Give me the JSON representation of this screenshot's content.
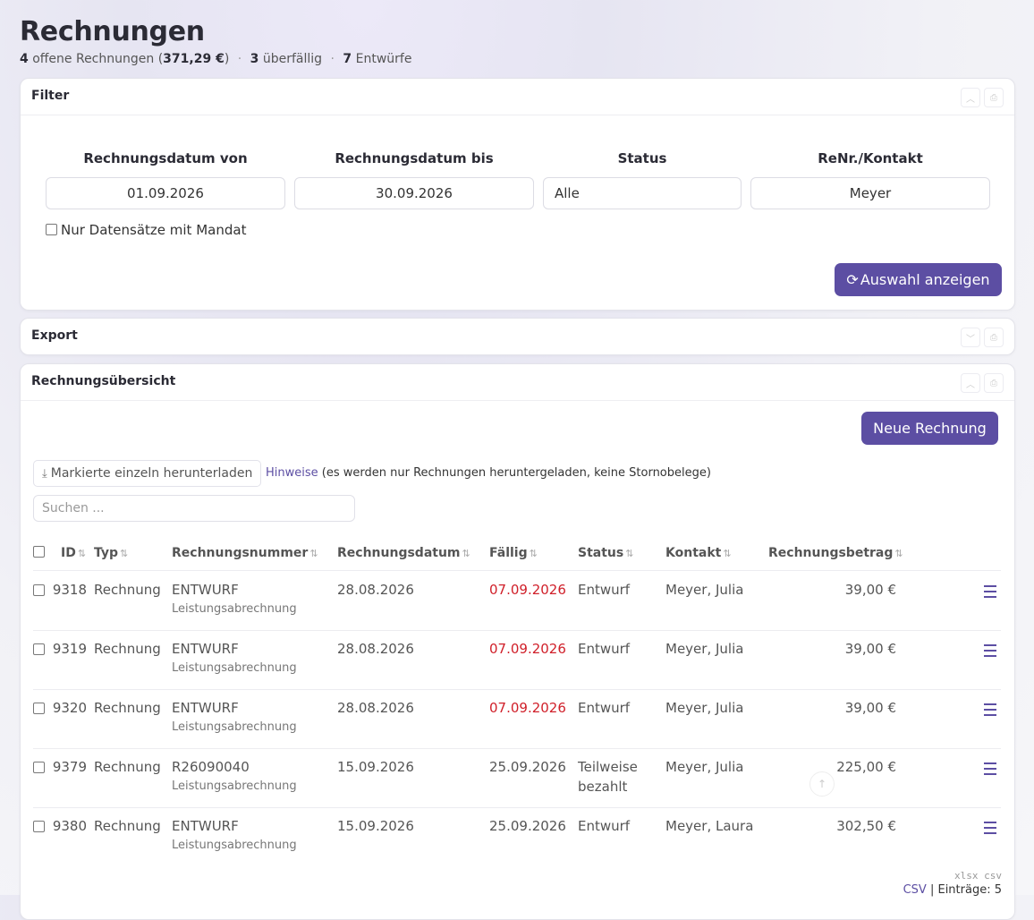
{
  "page": {
    "title": "Rechnungen",
    "summary": {
      "open_count": "4",
      "open_label": "offene Rechnungen",
      "open_amount": "371,29 €",
      "overdue_count": "3",
      "overdue_label": "überfällig",
      "draft_count": "7",
      "draft_label": "Entwürfe"
    }
  },
  "filter": {
    "title": "Filter",
    "date_from": {
      "label": "Rechnungsdatum von",
      "value": "01.09.2026"
    },
    "date_to": {
      "label": "Rechnungsdatum bis",
      "value": "30.09.2026"
    },
    "status": {
      "label": "Status",
      "value": "Alle"
    },
    "contact": {
      "label": "ReNr./Kontakt",
      "value": "Meyer"
    },
    "mandate_checkbox_label": "Nur Datensätze mit Mandat",
    "show_button_label": "Auswahl anzeigen"
  },
  "export": {
    "title": "Export"
  },
  "overview": {
    "title": "Rechnungsübersicht",
    "new_invoice_label": "Neue Rechnung",
    "download_label": "Markierte einzeln herunterladen",
    "hint_link": "Hinweise",
    "hint_text": "(es werden nur Rechnungen heruntergeladen, keine Stornobelege)",
    "search_placeholder": "Suchen ...",
    "columns": [
      "ID",
      "Typ",
      "Rechnungsnummer",
      "Rechnungsdatum",
      "Fällig",
      "Status",
      "Kontakt",
      "Rechnungsbetrag"
    ],
    "rows": [
      {
        "id": "9318",
        "type": "Rechnung",
        "number": "ENTWURF",
        "number_sub": "Leistungsabrechnung",
        "date": "28.08.2026",
        "due": "07.09.2026",
        "due_overdue": true,
        "status": "Entwurf",
        "status2": "",
        "contact": "Meyer, Julia",
        "amount": "39,00 €"
      },
      {
        "id": "9319",
        "type": "Rechnung",
        "number": "ENTWURF",
        "number_sub": "Leistungsabrechnung",
        "date": "28.08.2026",
        "due": "07.09.2026",
        "due_overdue": true,
        "status": "Entwurf",
        "status2": "",
        "contact": "Meyer, Julia",
        "amount": "39,00 €"
      },
      {
        "id": "9320",
        "type": "Rechnung",
        "number": "ENTWURF",
        "number_sub": "Leistungsabrechnung",
        "date": "28.08.2026",
        "due": "07.09.2026",
        "due_overdue": true,
        "status": "Entwurf",
        "status2": "",
        "contact": "Meyer, Julia",
        "amount": "39,00 €"
      },
      {
        "id": "9379",
        "type": "Rechnung",
        "number": "R26090040",
        "number_sub": "Leistungsabrechnung",
        "date": "15.09.2026",
        "due": "25.09.2026",
        "due_overdue": false,
        "status": "Teilweise",
        "status2": "bezahlt",
        "contact": "Meyer, Julia",
        "amount": "225,00 €"
      },
      {
        "id": "9380",
        "type": "Rechnung",
        "number": "ENTWURF",
        "number_sub": "Leistungsabrechnung",
        "date": "15.09.2026",
        "due": "25.09.2026",
        "due_overdue": false,
        "status": "Entwurf",
        "status2": "",
        "contact": "Meyer, Laura",
        "amount": "302,50 €"
      }
    ],
    "export_links": "xlsx csv",
    "footer_csv": "CSV",
    "footer_count": "| Einträge: 5"
  },
  "icons": {
    "refresh": "refresh-icon",
    "download": "download-icon",
    "menu": "hamburger-menu-icon",
    "collapse": "chevron-up-icon",
    "expand": "chevron-down-icon",
    "print": "print-icon",
    "scroll_top": "arrow-up-icon"
  },
  "colors": {
    "accent": "#5c4ea3",
    "overdue": "#d0202a"
  }
}
